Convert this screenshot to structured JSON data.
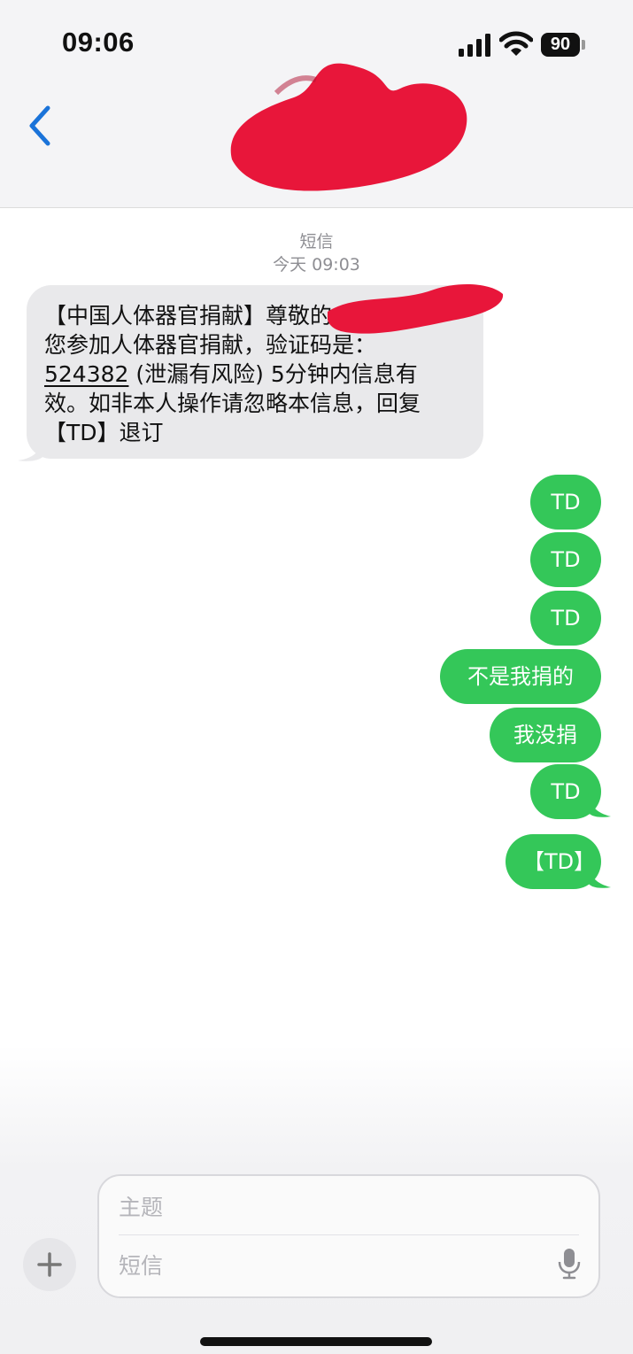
{
  "status_bar": {
    "time": "09:06",
    "battery": "90"
  },
  "header": {
    "back_icon": "chevron-left-icon",
    "contact_redacted": true
  },
  "thread": {
    "channel_label": "短信",
    "timestamp": "今天 09:03"
  },
  "incoming_message": {
    "lines": [
      "【中国人体器官捐献】尊敬的",
      "您参加人体器官捐献，验证码是：",
      "(泄漏有风险) 5分钟内信息有",
      "效。如非本人操作请忽略本信息，回复",
      "【TD】退订"
    ],
    "code": "524382"
  },
  "outgoing_messages": [
    {
      "text": "TD"
    },
    {
      "text": "TD"
    },
    {
      "text": "TD"
    },
    {
      "text": "不是我捐的"
    },
    {
      "text": "我没捐"
    },
    {
      "text": "TD"
    },
    {
      "text": "【TD】"
    }
  ],
  "composer": {
    "subject_placeholder": "主题",
    "body_placeholder": "短信",
    "add_icon": "plus-icon",
    "mic_icon": "microphone-icon"
  },
  "colors": {
    "outgoing_bubble": "#34c759",
    "incoming_bubble": "#e9e9eb",
    "accent": "#1a73d9",
    "redaction": "#e8163a"
  }
}
